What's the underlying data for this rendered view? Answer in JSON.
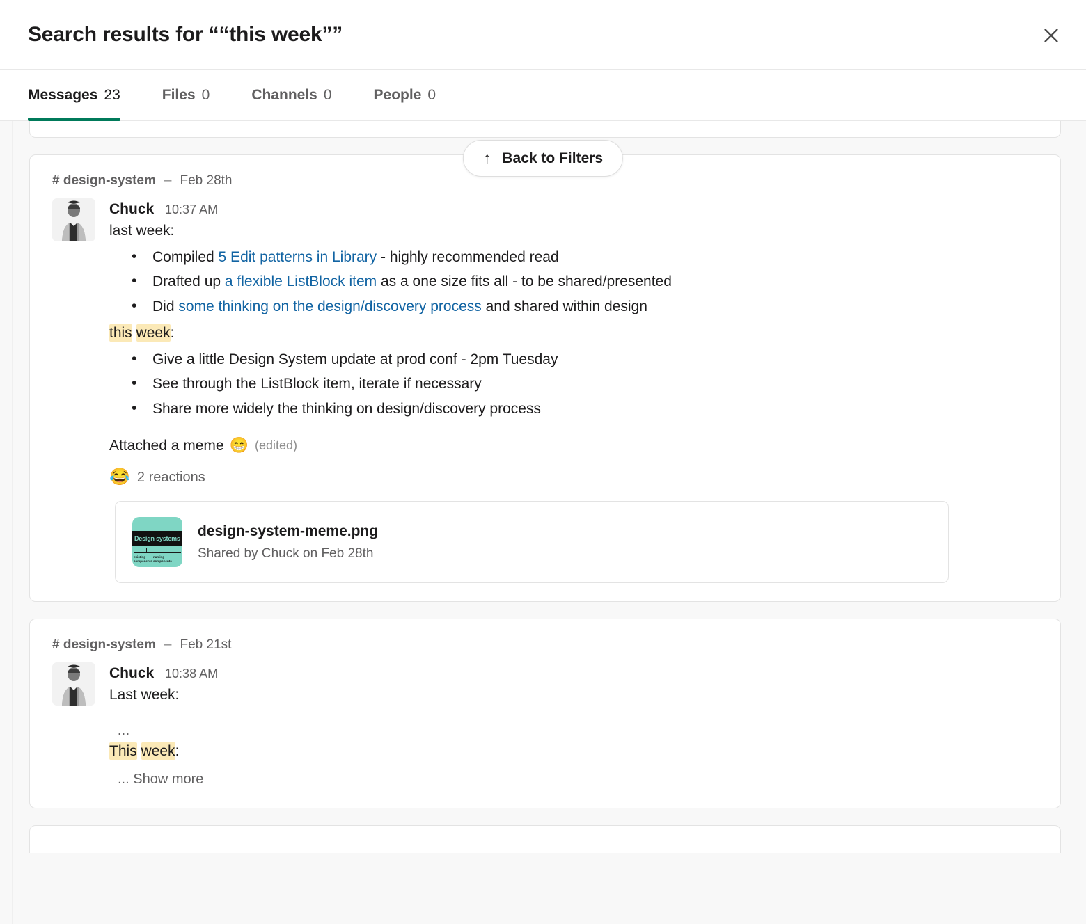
{
  "header": {
    "title": "Search results for ““this week””",
    "close_icon": "close-icon"
  },
  "tabs": [
    {
      "label": "Messages",
      "count": "23",
      "active": true
    },
    {
      "label": "Files",
      "count": "0",
      "active": false
    },
    {
      "label": "Channels",
      "count": "0",
      "active": false
    },
    {
      "label": "People",
      "count": "0",
      "active": false
    }
  ],
  "back_to_filters": {
    "arrow": "↑",
    "label": "Back to Filters"
  },
  "colors": {
    "accent_green": "#007a5a",
    "link_blue": "#1264a3",
    "highlight_yellow": "#fbe9b7",
    "page_bg": "#f8f8f8",
    "text_primary": "#1d1c1d",
    "text_muted": "#616061"
  },
  "results": [
    {
      "channel": "# design-system",
      "separator": "–",
      "date": "Feb 28th",
      "author": "Chuck",
      "time": "10:37 AM",
      "intro": "last week:",
      "last_week_items": [
        {
          "pre": "Compiled ",
          "link": "5 Edit patterns in Library",
          "post": " - highly recommended read"
        },
        {
          "pre": "Drafted up ",
          "link": "a flexible ListBlock item",
          "post": " as a one size fits all - to be shared/presented"
        },
        {
          "pre": "Did ",
          "link": "some thinking on the design/discovery process",
          "post": " and shared within design"
        }
      ],
      "this_week_label": {
        "hl1": "this",
        "hl2": "week",
        "tail": ":"
      },
      "this_week_items": [
        "Give a little Design System update at prod conf - 2pm Tuesday",
        "See through the ListBlock item, iterate if necessary",
        "Share more widely the thinking on design/discovery process"
      ],
      "attached_text": "Attached a meme",
      "attached_emoji": "😁",
      "edited_label": "(edited)",
      "reaction_emoji": "😂",
      "reaction_label": "2 reactions",
      "file": {
        "name": "design-system-meme.png",
        "shared_by": "Shared by Chuck on Feb 28th",
        "thumb_title": "Design systems",
        "thumb_caption_left": "existing components",
        "thumb_caption_right": "naming components"
      }
    },
    {
      "channel": "# design-system",
      "separator": "–",
      "date": "Feb 21st",
      "author": "Chuck",
      "time": "10:38 AM",
      "intro": "Last week:",
      "ellipsis": "...",
      "this_week_label": {
        "hl1": "This",
        "hl2": "week",
        "tail": ":"
      },
      "show_more": "... Show more"
    }
  ]
}
